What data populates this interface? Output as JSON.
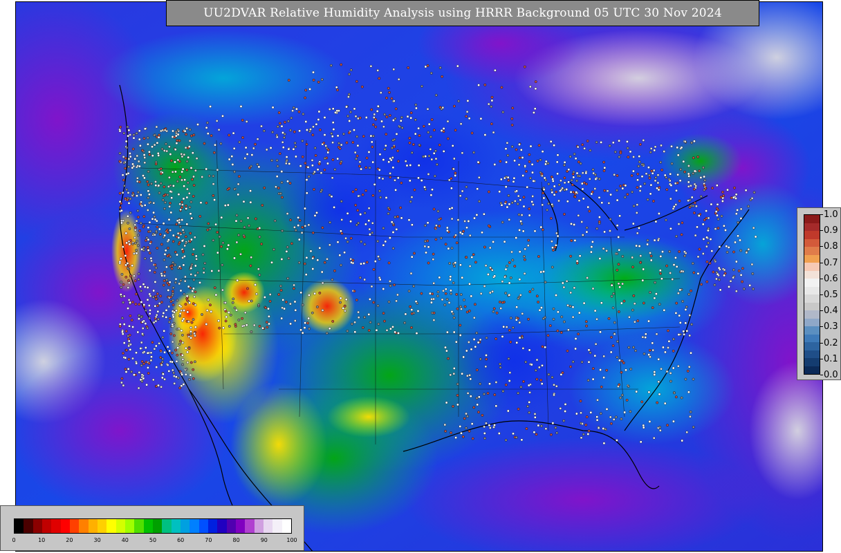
{
  "title": "UU2DVAR Relative Humidity Analysis using HRRR Background 05 UTC 30 Nov 2024",
  "right_colorbar": {
    "labels": [
      "1.0",
      "0.9",
      "0.8",
      "0.7",
      "0.6",
      "0.5",
      "0.4",
      "0.3",
      "0.2",
      "0.1",
      "0.0"
    ],
    "colors": [
      "#8b1a1a",
      "#a52a2a",
      "#c0392b",
      "#d35a3a",
      "#e07c4a",
      "#f0a050",
      "#f6c9b4",
      "#f3e2d8",
      "#f2f2f2",
      "#e8e8e8",
      "#d8d8d8",
      "#c8c8c8",
      "#b0b8c8",
      "#8fa8c8",
      "#5b8fc0",
      "#3e7ab8",
      "#2d64a0",
      "#1f4e88",
      "#143c70",
      "#0b2a58"
    ]
  },
  "bottom_colorbar": {
    "labels": [
      "0",
      "10",
      "20",
      "30",
      "40",
      "50",
      "60",
      "70",
      "80",
      "90",
      "100"
    ],
    "colors": [
      "#000000",
      "#4a0000",
      "#8b0000",
      "#c00000",
      "#e00000",
      "#ff0000",
      "#ff4000",
      "#ff8000",
      "#ffb000",
      "#ffd000",
      "#ffff00",
      "#d4ff00",
      "#a0ff00",
      "#50e000",
      "#00c000",
      "#00a000",
      "#00c080",
      "#00c0c0",
      "#00a0e0",
      "#0080ff",
      "#0050ff",
      "#0020e0",
      "#2000c0",
      "#5000b0",
      "#8000c0",
      "#b040d0",
      "#d0a0e0",
      "#e8d8f0",
      "#f4f0f8",
      "#ffffff"
    ]
  },
  "colors": {
    "title_bg": "#8a8a8a",
    "legend_bg": "#c6c6c6",
    "ocean_low": "#1040e0",
    "ocean_high": "#7a10c0",
    "dry": "#ff2000",
    "moist": "#00c000"
  }
}
